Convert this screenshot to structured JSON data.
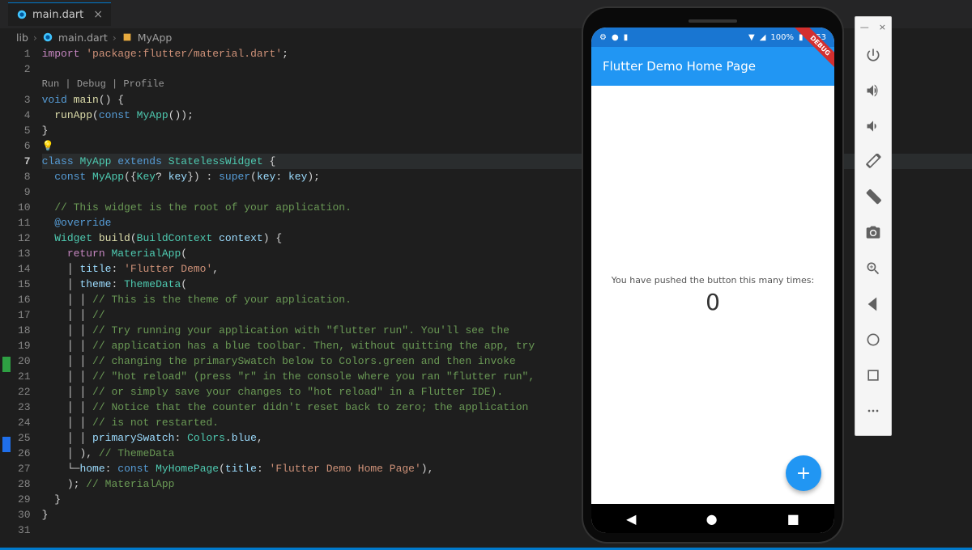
{
  "tab": {
    "filename": "main.dart",
    "close": "×"
  },
  "breadcrumb": {
    "p0": "lib",
    "p1": "main.dart",
    "p2": "MyApp",
    "sep": "›"
  },
  "codelens": "Run | Debug | Profile",
  "lines": {
    "l1_kw": "import",
    "l1_str": "'package:flutter/material.dart'",
    "l1_pun": ";",
    "l3_kw": "void",
    "l3_fn": "main",
    "l3_rest": "() {",
    "l4_fn": "runApp",
    "l4_p1": "(",
    "l4_kw": "const",
    "l4_cls": "MyApp",
    "l4_rest": "());",
    "l5": "}",
    "l7_kw1": "class",
    "l7_cls1": "MyApp",
    "l7_kw2": "extends",
    "l7_cls2": "StatelessWidget",
    "l7_rest": " {",
    "l8_kw": "const",
    "l8_cls": "MyApp",
    "l8_p1": "({",
    "l8_cls2": "Key",
    "l8_q": "?",
    "l8_var": "key",
    "l8_p2": "}) : ",
    "l8_kw2": "super",
    "l8_p3": "(",
    "l8_var2": "key",
    "l8_p4": ": ",
    "l8_var3": "key",
    "l8_p5": ");",
    "l10": "// This widget is the root of your application.",
    "l11": "@override",
    "l12_cls": "Widget",
    "l12_fn": "build",
    "l12_p1": "(",
    "l12_cls2": "BuildContext",
    "l12_var": "context",
    "l12_p2": ") {",
    "l13_kw": "return",
    "l13_cls": "MaterialApp",
    "l13_p": "(",
    "l14_var": "title",
    "l14_p": ": ",
    "l14_str": "'Flutter Demo'",
    "l14_c": ",",
    "l15_var": "theme",
    "l15_p": ": ",
    "l15_cls": "ThemeData",
    "l15_p2": "(",
    "l16": "// This is the theme of your application.",
    "l17": "//",
    "l18": "// Try running your application with \"flutter run\". You'll see the",
    "l19": "// application has a blue toolbar. Then, without quitting the app, try",
    "l20": "// changing the primarySwatch below to Colors.green and then invoke",
    "l21": "// \"hot reload\" (press \"r\" in the console where you ran \"flutter run\",",
    "l22": "// or simply save your changes to \"hot reload\" in a Flutter IDE).",
    "l23": "// Notice that the counter didn't reset back to zero; the application",
    "l24": "// is not restarted.",
    "l25_var": "primarySwatch",
    "l25_p": ": ",
    "l25_cls": "Colors",
    "l25_d": ".",
    "l25_var2": "blue",
    "l25_c": ",",
    "l26_p": "), ",
    "l26_com": "// ThemeData",
    "l27_var": "home",
    "l27_p": ": ",
    "l27_kw": "const",
    "l27_cls": "MyHomePage",
    "l27_p2": "(",
    "l27_var2": "title",
    "l27_p3": ": ",
    "l27_str": "'Flutter Demo Home Page'",
    "l27_p4": "),",
    "l28_p": "); ",
    "l28_com": "// MaterialApp",
    "l29": "}",
    "l30": "}"
  },
  "line_numbers": [
    "1",
    "2",
    "3",
    "4",
    "5",
    "6",
    "7",
    "8",
    "9",
    "10",
    "11",
    "12",
    "13",
    "14",
    "15",
    "16",
    "17",
    "18",
    "19",
    "20",
    "21",
    "22",
    "23",
    "24",
    "25",
    "26",
    "27",
    "28",
    "29",
    "30",
    "31"
  ],
  "phone": {
    "status": {
      "battery": "100%",
      "time": "4:53"
    },
    "app_title": "Flutter Demo Home Page",
    "body_text": "You have pushed the button this many times:",
    "counter": "0",
    "fab": "+",
    "debug": "DEBUG"
  }
}
